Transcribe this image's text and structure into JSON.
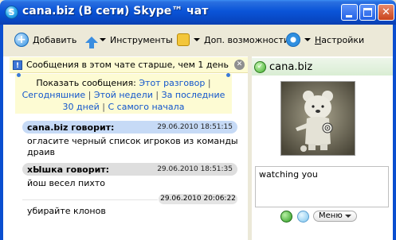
{
  "window": {
    "title": "cana.biz (В сети) Skype™ чат",
    "minimize_label": "_",
    "maximize_label": "□",
    "close_label": "✕"
  },
  "toolbar": {
    "add": "Добавить",
    "tools": "Инструменты",
    "extras": "Доп. возможности",
    "settings": "Настройки"
  },
  "notice": {
    "text": "Сообщения в этом чате старше, чем 1 день",
    "icon_glyph": "!",
    "close_glyph": "✕"
  },
  "history": {
    "prefix": "Показать сообщения:",
    "this_conversation": "Этот разговор",
    "today": "Сегодняшние",
    "this_week": "Этой недели",
    "last_30_days_a": "За последние",
    "last_30_days_b": "30 дней",
    "from_start": "С самого начала",
    "sep": "|"
  },
  "messages": [
    {
      "author": "cana.biz говорит:",
      "time": "29.06.2010 18:51:15",
      "text_line1": "огласите черный список игроков из команды",
      "text_line2": "драив"
    },
    {
      "author": "хЫшка говорит:",
      "time": "29.06.2010 18:51:35",
      "text_line1": "йош весел пихто"
    },
    {
      "time": "29.06.2010 20:06:22",
      "text_line1": "убирайте клонов"
    }
  ],
  "contact": {
    "name": "cana.biz",
    "status_glyph": "✓",
    "mood_text": "watching you",
    "menu_label": "Меню"
  },
  "colors": {
    "titlebar": "#0a54d8",
    "window_bg": "#ece9d8",
    "notice_bg": "#fdfbd3",
    "own_header": "#c6daf6",
    "other_header": "#dedede",
    "link": "#1155cc"
  }
}
